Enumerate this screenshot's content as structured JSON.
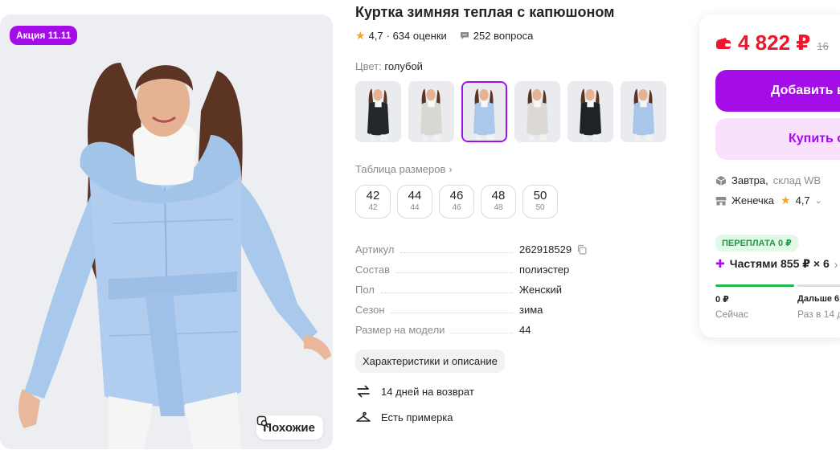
{
  "product": {
    "title": "Куртка зимняя теплая с капюшоном",
    "rating": "4,7",
    "reviews": "· 634 оценки",
    "questions": "252 вопроса",
    "promo_badge": "Акция 11.11",
    "similar_label": "Похожие"
  },
  "color": {
    "label": "Цвет:",
    "value": "голубой"
  },
  "thumbnails": [
    {
      "jacket": "#22272b",
      "selected": false
    },
    {
      "jacket": "#d9d7d3",
      "selected": false
    },
    {
      "jacket": "#a9c8ea",
      "selected": true
    },
    {
      "jacket": "#dcd9d5",
      "selected": false
    },
    {
      "jacket": "#1e2327",
      "selected": false
    },
    {
      "jacket": "#a7c6e8",
      "selected": false
    }
  ],
  "size_table_link": "Таблица размеров",
  "sizes": [
    {
      "main": "42",
      "sub": "42"
    },
    {
      "main": "44",
      "sub": "44"
    },
    {
      "main": "46",
      "sub": "46"
    },
    {
      "main": "48",
      "sub": "48"
    },
    {
      "main": "50",
      "sub": "50"
    }
  ],
  "specs": [
    {
      "key": "Артикул",
      "value": "262918529"
    },
    {
      "key": "Состав",
      "value": "полиэстер"
    },
    {
      "key": "Пол",
      "value": "Женский"
    },
    {
      "key": "Сезон",
      "value": "зима"
    },
    {
      "key": "Размер на модели",
      "value": "44"
    }
  ],
  "characteristics_button": "Характеристики и описание",
  "features": [
    {
      "icon": "return-icon",
      "text": "14 дней на возврат"
    },
    {
      "icon": "hanger-icon",
      "text": "Есть примерка"
    }
  ],
  "buy": {
    "price": "4 822 ₽",
    "old_price": "16",
    "add_to_cart": "Добавить в",
    "buy_now": "Купить с",
    "delivery_day": "Завтра,",
    "delivery_where": "склад WB",
    "seller": "Женечка",
    "seller_rating": "4,7",
    "overpay": "ПЕРЕПЛАТА 0 ₽",
    "installments": "Частями 855 ₽ × 6",
    "pay_now_amount": "0 ₽",
    "pay_now_label": "Сейчас",
    "pay_later_amount": "Дальше 6",
    "pay_later_label": "Раз в 14 д"
  },
  "colors": {
    "accent": "#a40ce8",
    "price": "#f0142d",
    "green": "#1f9a43"
  }
}
